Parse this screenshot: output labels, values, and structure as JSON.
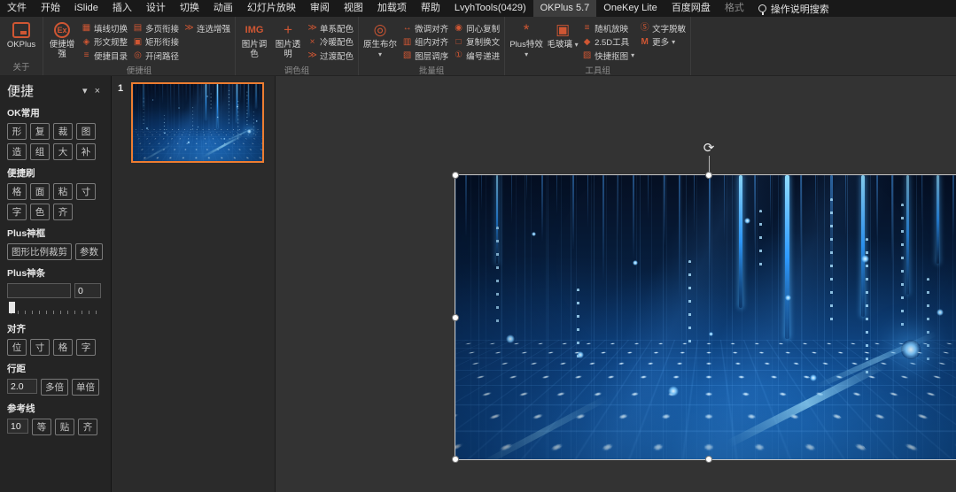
{
  "menu": {
    "tabs": [
      "文件",
      "开始",
      "iSlide",
      "插入",
      "设计",
      "切换",
      "动画",
      "幻灯片放映",
      "审阅",
      "视图",
      "加载项",
      "帮助",
      "LvyhTools(0429)",
      "OKPlus 5.7",
      "OneKey Lite",
      "百度网盘",
      "格式"
    ],
    "active_tab": "OKPlus 5.7",
    "search_label": "操作说明搜索"
  },
  "ribbon": {
    "caret": "▾",
    "groups": [
      {
        "label": "关于",
        "big": [
          {
            "label": "OKPlus",
            "icon": "okplus-logo"
          }
        ]
      },
      {
        "label": "便捷组",
        "big": [
          {
            "label": "便捷增强",
            "icon": "ex-badge"
          }
        ],
        "cols": [
          [
            "填线切换",
            "形文规整",
            "便捷目录"
          ],
          [
            "多页衔接",
            "矩形衔接",
            "开闭路径"
          ],
          [
            "连选增强"
          ]
        ]
      },
      {
        "label": "调色组",
        "big": [
          {
            "label": "图片调色",
            "icon": "img-adjust"
          },
          {
            "label": "图片透明",
            "icon": "img-transparent"
          }
        ],
        "cols": [
          [
            "单系配色",
            "冷暖配色",
            "过渡配色"
          ]
        ]
      },
      {
        "label": "批量组",
        "big": [
          {
            "label": "原生布尔",
            "icon": "boolean-shapes",
            "dropdown": true
          }
        ],
        "cols": [
          [
            "微调对齐",
            "组内对齐",
            "图层调序"
          ],
          [
            "同心复制",
            "复制换文",
            "编号递进"
          ]
        ]
      },
      {
        "label": "工具组",
        "big": [
          {
            "label": "Plus特效",
            "icon": "plus-effects",
            "dropdown": true
          },
          {
            "label": "毛玻璃",
            "icon": "frosted-glass",
            "dropdown": true
          }
        ],
        "cols": [
          [
            "随机放映",
            "2.5D工具",
            "快捷抠图"
          ],
          [
            "文字脱敏",
            "更多"
          ]
        ]
      }
    ]
  },
  "icons": {
    "ex": "Ex",
    "img_adjust": "IMG",
    "img_transparent": "+",
    "fill_line": "▦",
    "shape_text": "◈",
    "toc": "≡",
    "multipage": "▤",
    "rect_connect": "▣",
    "open_close_path": "◎",
    "multi_select": "≫",
    "single_scheme": "≫",
    "warm_cool": "×",
    "gradient_scheme": "≫",
    "boolean": "◎",
    "fine_align": "↔",
    "group_align": "▥",
    "layer_order": "▧",
    "concentric_copy": "◉",
    "copy_swap": "□",
    "number_prog": "①",
    "plus_effects": "*",
    "frosted": "▣",
    "random_show": "≡",
    "tool_25d": "◆",
    "cutout": "▨",
    "text_mask": "Ⓢ",
    "more": "M"
  },
  "sidebar": {
    "title": "便捷",
    "collapse_icon": "▾",
    "close_icon": "×",
    "sections": {
      "ok_common": {
        "label": "OK常用",
        "row1": [
          "形",
          "复",
          "裁",
          "图"
        ],
        "row2": [
          "造",
          "组",
          "大",
          "补"
        ]
      },
      "brush": {
        "label": "便捷刷",
        "row1": [
          "格",
          "面",
          "粘",
          "寸"
        ],
        "row2": [
          "字",
          "色",
          "齐"
        ]
      },
      "plus_frame": {
        "label": "Plus神框",
        "buttons": [
          "图形比例裁剪",
          "参数"
        ]
      },
      "plus_bar": {
        "label": "Plus神条",
        "input_value": "",
        "spin_value": "0"
      },
      "align": {
        "label": "对齐",
        "buttons": [
          "位",
          "寸",
          "格",
          "字"
        ]
      },
      "line_spacing": {
        "label": "行距",
        "value": "2.0",
        "buttons": [
          "多倍",
          "单倍"
        ]
      },
      "guides": {
        "label": "参考线",
        "value": "10",
        "buttons": [
          "等",
          "贴",
          "齐"
        ]
      }
    }
  },
  "slides": {
    "panel": [
      {
        "number": "1",
        "selected": true
      }
    ]
  },
  "canvas": {
    "rotation_glyph": "⟳"
  },
  "colors": {
    "ribbon_accent": "#cf5633",
    "thumbnail_selection_border": "#ed7d31",
    "canvas_bg": "#333333",
    "image_blue_dark": "#050f22",
    "image_blue_bright": "#0d4a8c"
  }
}
